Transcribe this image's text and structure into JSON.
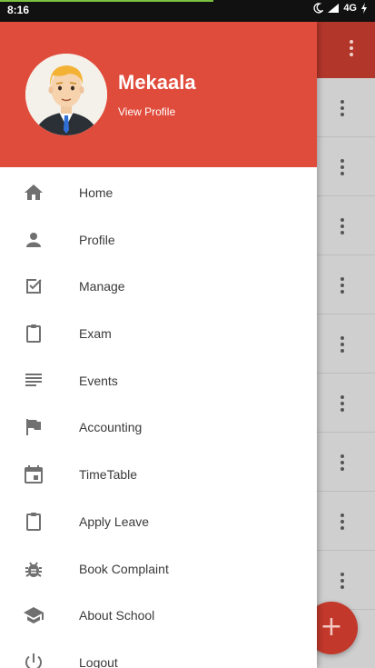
{
  "status_bar": {
    "time": "8:16",
    "network": "4G"
  },
  "header": {
    "user_name": "Mekaala",
    "view_profile_label": "View Profile"
  },
  "menu": {
    "items": [
      {
        "label": "Home",
        "icon": "home-icon"
      },
      {
        "label": "Profile",
        "icon": "person-icon"
      },
      {
        "label": "Manage",
        "icon": "checkbox-icon"
      },
      {
        "label": "Exam",
        "icon": "clipboard-icon"
      },
      {
        "label": "Events",
        "icon": "list-icon"
      },
      {
        "label": "Accounting",
        "icon": "flag-icon"
      },
      {
        "label": "TimeTable",
        "icon": "calendar-icon"
      },
      {
        "label": "Apply Leave",
        "icon": "clipboard-icon"
      },
      {
        "label": "Book Complaint",
        "icon": "bug-icon"
      },
      {
        "label": "About School",
        "icon": "school-icon"
      },
      {
        "label": "Logout",
        "icon": "power-icon"
      }
    ]
  },
  "fab": {
    "label": "+"
  },
  "colors": {
    "header": "#e04c3c",
    "icon": "#707070",
    "fab": "#c2382b"
  }
}
